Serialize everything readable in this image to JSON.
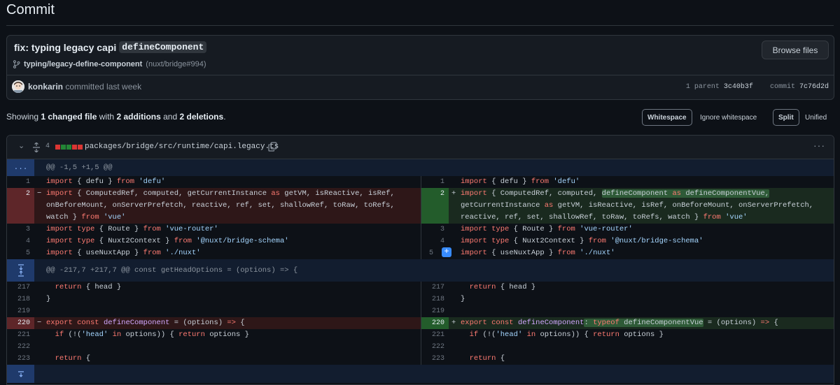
{
  "page": {
    "title": "Commit"
  },
  "commit": {
    "message_prefix": "fix: typing legacy capi",
    "message_code": "defineComponent",
    "branch": "typing/legacy-define-component",
    "pr": "(nuxt/bridge#994)",
    "browse_files_label": "Browse files",
    "author": "konkarin",
    "action": "committed last week",
    "parent_label": "1 parent",
    "parent_sha": "3c40b3f",
    "commit_label": "commit",
    "commit_sha": "7c76d2d"
  },
  "summary": {
    "showing": "Showing",
    "files": "1 changed file",
    "with": "with",
    "additions": "2 additions",
    "and": "and",
    "deletions": "2 deletions",
    "end": "."
  },
  "toolbar": {
    "whitespace": "Whitespace",
    "ignore_whitespace": "Ignore whitespace",
    "split": "Split",
    "unified": "Unified"
  },
  "file": {
    "changes": "4",
    "path": "packages/bridge/src/runtime/capi.legacy.ts",
    "diffstat": [
      "#da3633",
      "#238636",
      "#238636",
      "#da3633",
      "#da3633"
    ],
    "hunk1": "@@ -1,5 +1,5 @@",
    "hunk2": "@@ -217,7 +217,7 @@ const getHeadOptions = (options) => {",
    "expand_all_label": "...",
    "left": [
      {
        "n": "1",
        "t": "import { defu } from 'defu'"
      },
      {
        "n": "2",
        "t": "import { ComputedRef, computed, getCurrentInstance as getVM, isReactive, isRef, onBeforeMount, onServerPrefetch, reactive, ref, set, shallowRef, toRaw, toRefs, watch } from 'vue'"
      },
      {
        "n": "3",
        "t": "import type { Route } from 'vue-router'"
      },
      {
        "n": "4",
        "t": "import type { Nuxt2Context } from '@nuxt/bridge-schema'"
      },
      {
        "n": "5",
        "t": "import { useNuxtApp } from './nuxt'"
      },
      {
        "n": "217",
        "t": "  return { head }"
      },
      {
        "n": "218",
        "t": "}"
      },
      {
        "n": "219",
        "t": ""
      },
      {
        "n": "220",
        "t": "export const defineComponent = (options) => {"
      },
      {
        "n": "221",
        "t": "  if (!('head' in options)) { return options }"
      },
      {
        "n": "222",
        "t": ""
      },
      {
        "n": "223",
        "t": "  return {"
      }
    ],
    "right": [
      {
        "n": "1",
        "t": "import { defu } from 'defu'"
      },
      {
        "n": "2",
        "t": "import { ComputedRef, computed, defineComponent as defineComponentVue, getCurrentInstance as getVM, isReactive, isRef, onBeforeMount, onServerPrefetch, reactive, ref, set, shallowRef, toRaw, toRefs, watch } from 'vue'"
      },
      {
        "n": "3",
        "t": "import type { Route } from 'vue-router'"
      },
      {
        "n": "4",
        "t": "import type { Nuxt2Context } from '@nuxt/bridge-schema'"
      },
      {
        "n": "5",
        "t": "import { useNuxtApp } from './nuxt'"
      },
      {
        "n": "217",
        "t": "  return { head }"
      },
      {
        "n": "218",
        "t": "}"
      },
      {
        "n": "219",
        "t": ""
      },
      {
        "n": "220",
        "t": "export const defineComponent: typeof defineComponentVue = (options) => {"
      },
      {
        "n": "221",
        "t": "  if (!('head' in options)) { return options }"
      },
      {
        "n": "222",
        "t": ""
      },
      {
        "n": "223",
        "t": "  return {"
      }
    ]
  }
}
